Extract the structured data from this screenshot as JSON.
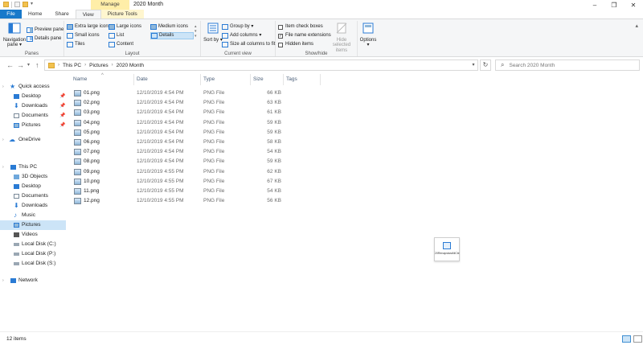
{
  "window": {
    "title": "2020 Month",
    "manage_tab": "Manage",
    "min_glyph": "–",
    "max_glyph": "❐",
    "close_glyph": "✕"
  },
  "ribbon_tabs": [
    "File",
    "Home",
    "Share",
    "View",
    "Picture Tools"
  ],
  "ribbon": {
    "panes": {
      "navigation_pane": "Navigation pane ▾",
      "preview_pane": "Preview pane",
      "details_pane": "Details pane",
      "label": "Panes"
    },
    "layout": {
      "items": [
        "Extra large icons",
        "Large icons",
        "Medium icons",
        "Small icons",
        "List",
        "Details",
        "Tiles",
        "Content"
      ],
      "selected": "Details",
      "label": "Layout"
    },
    "current_view": {
      "sort_by": "Sort by ▾",
      "group_by": "Group by ▾",
      "add_columns": "Add columns ▾",
      "size_all_columns": "Size all columns to fit",
      "label": "Current view"
    },
    "show_hide": {
      "item_check_boxes": "Item check boxes",
      "item_check_boxes_checked": false,
      "file_name_extensions": "File name extensions",
      "file_name_extensions_checked": true,
      "hidden_items": "Hidden items",
      "hidden_items_checked": false,
      "hide_selected_items": "Hide selected items",
      "label": "Show/hide"
    },
    "options": "Options ▾"
  },
  "address": {
    "crumbs": [
      "This PC",
      "Pictures",
      "2020 Month"
    ],
    "search_placeholder": "Search 2020 Month"
  },
  "nav_pane": {
    "quick_access": "Quick access",
    "quick_items": [
      "Desktop",
      "Downloads",
      "Documents",
      "Pictures"
    ],
    "onedrive": "OneDrive",
    "this_pc": "This PC",
    "pc_items": [
      "3D Objects",
      "Desktop",
      "Documents",
      "Downloads",
      "Music",
      "Pictures",
      "Videos",
      "Local Disk (C:)",
      "Local Disk (P:)",
      "Local Disk (S:)"
    ],
    "selected": "Pictures",
    "network": "Network"
  },
  "columns": [
    "Name",
    "Date",
    "Type",
    "Size",
    "Tags"
  ],
  "files": [
    {
      "name": "01.png",
      "date": "12/10/2019 4:54 PM",
      "type": "PNG File",
      "size": "66 KB"
    },
    {
      "name": "02.png",
      "date": "12/10/2019 4:54 PM",
      "type": "PNG File",
      "size": "63 KB"
    },
    {
      "name": "03.png",
      "date": "12/10/2019 4:54 PM",
      "type": "PNG File",
      "size": "61 KB"
    },
    {
      "name": "04.png",
      "date": "12/10/2019 4:54 PM",
      "type": "PNG File",
      "size": "59 KB"
    },
    {
      "name": "05.png",
      "date": "12/10/2019 4:54 PM",
      "type": "PNG File",
      "size": "59 KB"
    },
    {
      "name": "06.png",
      "date": "12/10/2019 4:54 PM",
      "type": "PNG File",
      "size": "58 KB"
    },
    {
      "name": "07.png",
      "date": "12/10/2019 4:54 PM",
      "type": "PNG File",
      "size": "54 KB"
    },
    {
      "name": "08.png",
      "date": "12/10/2019 4:54 PM",
      "type": "PNG File",
      "size": "59 KB"
    },
    {
      "name": "09.png",
      "date": "12/10/2019 4:55 PM",
      "type": "PNG File",
      "size": "62 KB"
    },
    {
      "name": "10.png",
      "date": "12/10/2019 4:55 PM",
      "type": "PNG File",
      "size": "67 KB"
    },
    {
      "name": "11.png",
      "date": "12/10/2019 4:55 PM",
      "type": "PNG File",
      "size": "54 KB"
    },
    {
      "name": "12.png",
      "date": "12/10/2019 4:55 PM",
      "type": "PNG File",
      "size": "56 KB"
    }
  ],
  "drag_thumbnail": {
    "label": "20RenapstaraNiCle"
  },
  "status": {
    "count": "12 items"
  },
  "colors": {
    "accent": "#1979ca",
    "selection": "#cce4f7",
    "manage": "#ffeea8",
    "folder": "#f2c14e"
  }
}
